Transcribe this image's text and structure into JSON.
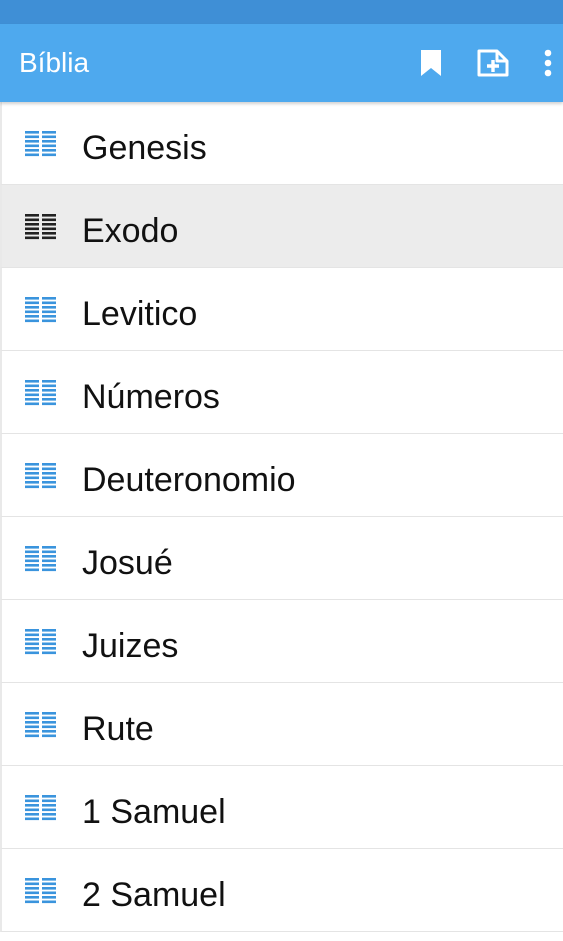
{
  "colors": {
    "status_bar": "#3f8fd6",
    "app_bar": "#4ea9ee",
    "icon_blue": "#3a94dd",
    "icon_selected": "#222222",
    "selected_row": "#ececec"
  },
  "app_bar": {
    "title": "Bíblia",
    "actions": [
      {
        "icon": "bookmark-icon"
      },
      {
        "icon": "add-book-icon"
      },
      {
        "icon": "more-vert-icon"
      }
    ]
  },
  "books": [
    {
      "label": "Genesis",
      "selected": false
    },
    {
      "label": "Exodo",
      "selected": true
    },
    {
      "label": "Levitico",
      "selected": false
    },
    {
      "label": "Números",
      "selected": false
    },
    {
      "label": "Deuteronomio",
      "selected": false
    },
    {
      "label": "Josué",
      "selected": false
    },
    {
      "label": "Juizes",
      "selected": false
    },
    {
      "label": "Rute",
      "selected": false
    },
    {
      "label": "1 Samuel",
      "selected": false
    },
    {
      "label": "2 Samuel",
      "selected": false
    }
  ]
}
